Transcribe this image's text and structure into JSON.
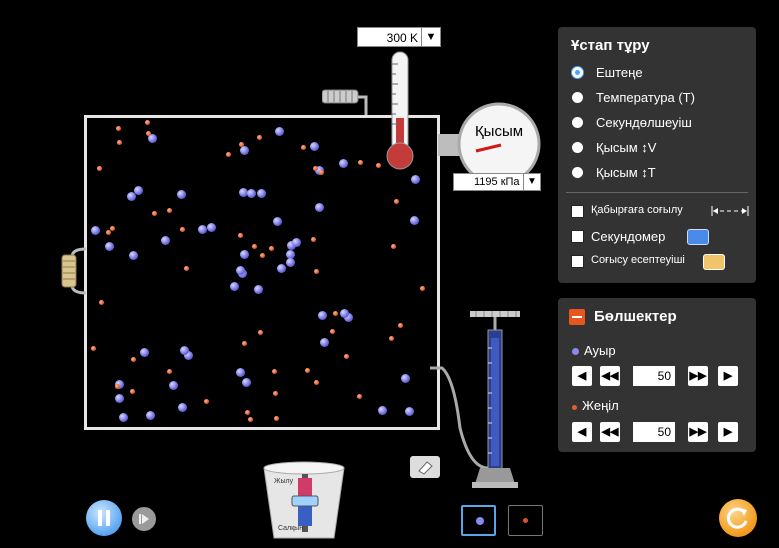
{
  "thermometer": {
    "value": "300 K",
    "dropdown_icon": "triangle-down"
  },
  "gauge": {
    "label": "Қысым",
    "value": "1195 кПа",
    "dropdown_icon": "triangle-down"
  },
  "hold_constant": {
    "title": "Ұстап тұру",
    "options": [
      "Ештеңе",
      "Температура (T)",
      "Секундөлшеуіш",
      "Қысым ↕V",
      "Қысым ↕T"
    ],
    "selected_index": 0,
    "checks": [
      {
        "label": "Қабырғаға соғылу",
        "checked": false
      },
      {
        "label": "Секундомер",
        "checked": false
      },
      {
        "label": "Соғысу есептеуіші",
        "checked": false
      }
    ]
  },
  "particles": {
    "title": "Бөлшектер",
    "heavy": {
      "label": "Ауыр",
      "value": "50"
    },
    "light": {
      "label": "Жеңіл",
      "value": "50"
    }
  },
  "heater": {
    "top_label": "Жылу",
    "bottom_label": "Салқын"
  },
  "colors": {
    "heavy": "#6a6ae0",
    "light": "#d9542a",
    "panel": "#333333",
    "accent": "#4aa3ff"
  }
}
